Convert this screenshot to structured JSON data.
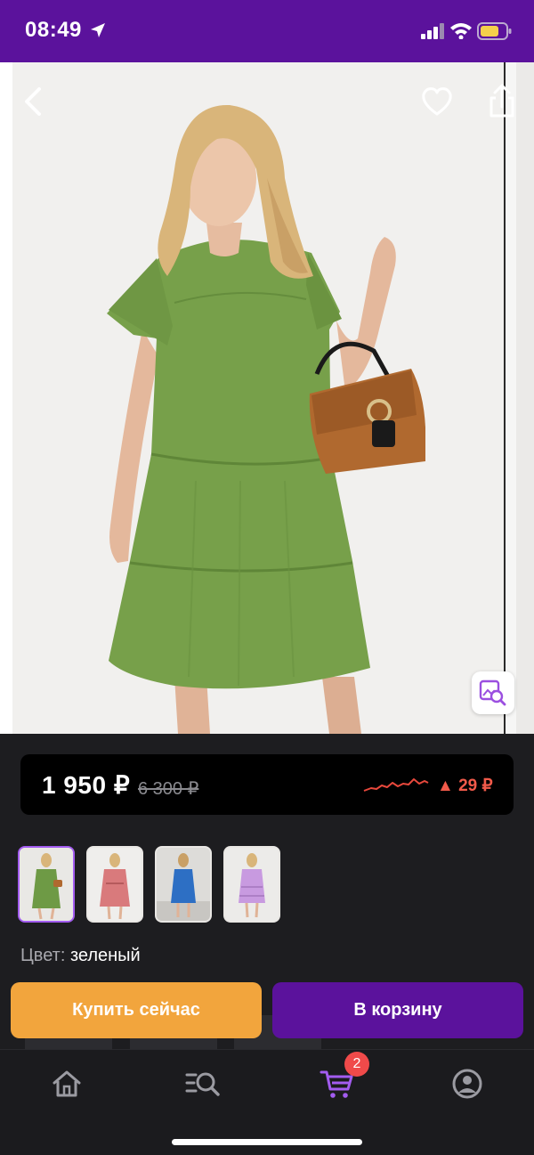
{
  "status_bar": {
    "time": "08:49"
  },
  "price": {
    "current": "1 950 ₽",
    "old": "6 300 ₽",
    "change": "▲ 29 ₽",
    "change_color": "#f15a4a",
    "trend_icon": "price-trend-line"
  },
  "colors": {
    "thumbnails": [
      {
        "dress_color": "#6e9a45",
        "selected": true
      },
      {
        "dress_color": "#d97a7c",
        "selected": false
      },
      {
        "dress_color": "#2d6fc4",
        "selected": false
      },
      {
        "dress_color": "#c89ae0",
        "selected": false
      }
    ],
    "label": "Цвет:",
    "value": "зеленый"
  },
  "actions": {
    "buy_now": "Купить сейчас",
    "add_to_cart": "В корзину",
    "buy_now_color": "#f2a53d",
    "add_to_cart_color": "#5b129c"
  },
  "tabbar": {
    "items": [
      "home-icon",
      "catalog-search-icon",
      "cart-icon",
      "profile-icon"
    ],
    "cart_badge": "2",
    "active_color": "#a35cf0"
  },
  "theme": {
    "brand": "#5b129c",
    "background": "#1d1d20"
  }
}
